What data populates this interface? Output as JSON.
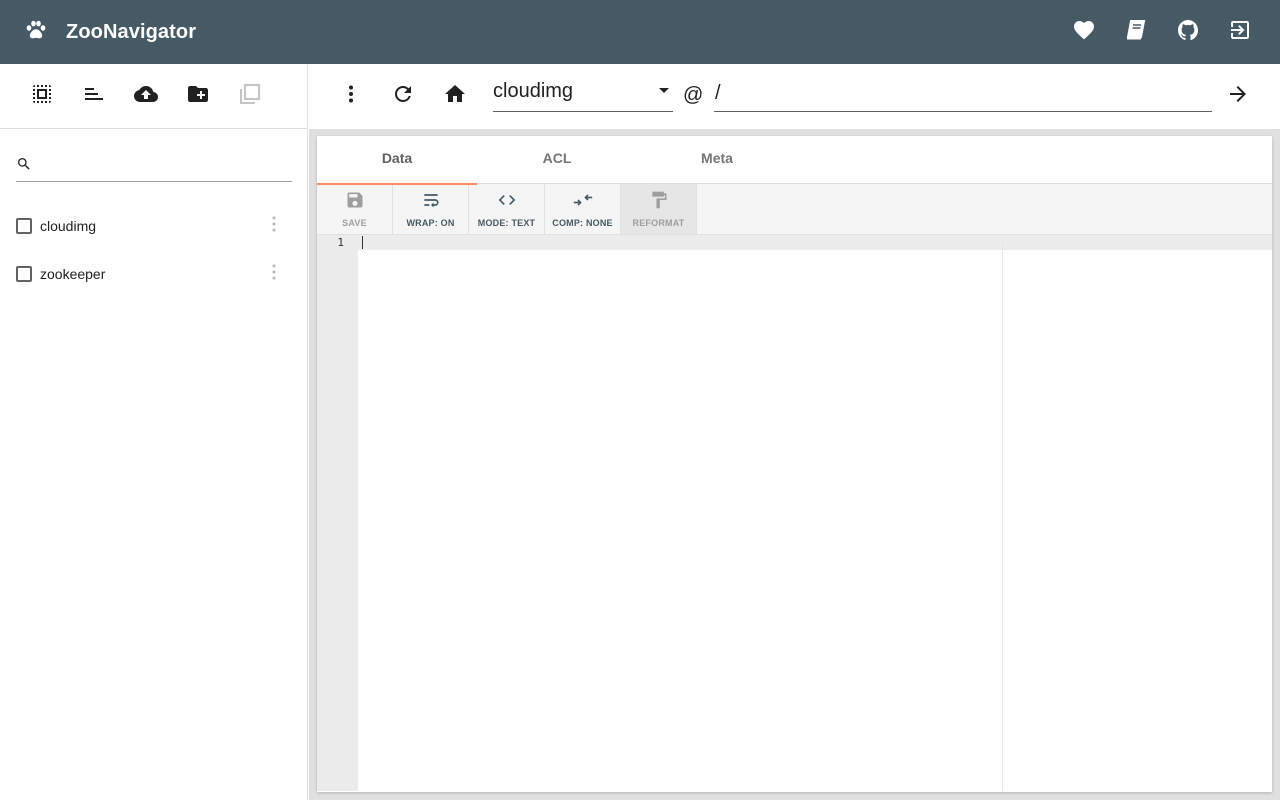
{
  "app": {
    "title": "ZooNavigator"
  },
  "colors": {
    "appbar": "#455a64",
    "tab_indicator": "#ff8a65",
    "toolbar_text": "#455a64"
  },
  "header_actions": [
    {
      "name": "donate",
      "icon": "heart-icon"
    },
    {
      "name": "docs",
      "icon": "book-icon"
    },
    {
      "name": "github",
      "icon": "github-icon"
    },
    {
      "name": "logout",
      "icon": "logout-icon"
    }
  ],
  "sidebar": {
    "toolbar": [
      {
        "name": "select-all",
        "icon": "select-all-icon"
      },
      {
        "name": "sort",
        "icon": "sort-icon"
      },
      {
        "name": "import",
        "icon": "cloud-upload-icon"
      },
      {
        "name": "create-node",
        "icon": "folder-add-icon"
      },
      {
        "name": "duplicate",
        "icon": "copy-icon"
      }
    ],
    "search": {
      "placeholder": "",
      "value": ""
    },
    "nodes": [
      {
        "label": "cloudimg",
        "checked": false
      },
      {
        "label": "zookeeper",
        "checked": false
      }
    ]
  },
  "topbar": {
    "connection": "cloudimg",
    "at": "@",
    "path": "/"
  },
  "tabs": [
    {
      "label": "Data",
      "active": true
    },
    {
      "label": "ACL",
      "active": false
    },
    {
      "label": "Meta",
      "active": false
    }
  ],
  "editor_toolbar": {
    "save": "SAVE",
    "wrap": "WRAP: ON",
    "mode": "MODE: TEXT",
    "comp": "COMP: NONE",
    "reformat": "REFORMAT"
  },
  "editor": {
    "line_numbers": [
      "1"
    ]
  }
}
